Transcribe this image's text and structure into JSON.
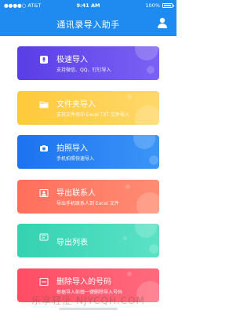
{
  "status_bar": {
    "carrier": "●●●●○ AT&T",
    "time": "9:41 AM",
    "battery": "100%"
  },
  "nav": {
    "title": "通讯录导入助手",
    "user_icon": "user-icon"
  },
  "cards": [
    {
      "title": "极速导入",
      "subtitle": "支持微信、QQ、钉钉导入",
      "icon": "lock-icon",
      "color": "#6a4ff0"
    },
    {
      "title": "文件夹导入",
      "subtitle": "支持文件夹中 Excel TXT 文件导入",
      "icon": "folder-icon",
      "color": "#ffd04a"
    },
    {
      "title": "拍照导入",
      "subtitle": "手机拍照快速导入",
      "icon": "camera-icon",
      "color": "#2a82f3"
    },
    {
      "title": "导出联系人",
      "subtitle": "导出手机联系人到 Excel 文件",
      "icon": "contact-card-icon",
      "color": "#ff7b66"
    },
    {
      "title": "导出列表",
      "subtitle": "",
      "icon": "list-icon",
      "color": "#45dabc"
    },
    {
      "title": "删除导入的号码",
      "subtitle": "根据导入前缀一键删除导入号码",
      "icon": "delete-icon",
      "color": "#ff5a70"
    }
  ],
  "watermark": "乐享轻沚 NJYCQH.COM"
}
